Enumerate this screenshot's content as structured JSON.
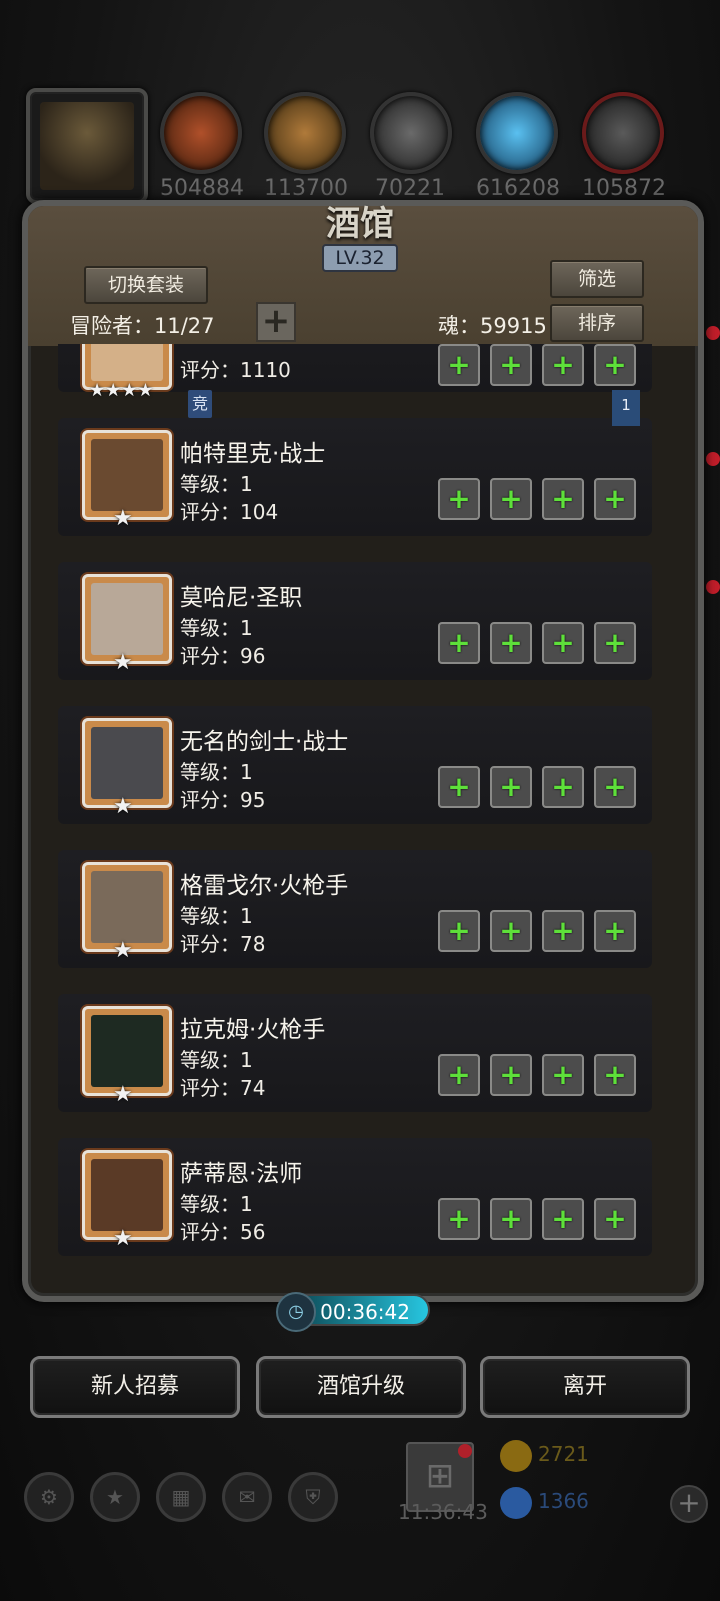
{
  "resources": [
    {
      "icon": "leather-icon",
      "value": "504884",
      "color": "#7a3a1a"
    },
    {
      "icon": "wood-icon",
      "value": "113700",
      "color": "#8a5a2a"
    },
    {
      "icon": "iron-icon",
      "value": "70221",
      "color": "#4a4a4a"
    },
    {
      "icon": "crystal-icon",
      "value": "616208",
      "color": "#2a8ac8"
    },
    {
      "icon": "ingot-icon",
      "value": "105872",
      "color": "#3a3a3a"
    }
  ],
  "tavern": {
    "title": "酒馆",
    "level": "LV.32",
    "switch_outfit": "切换套装",
    "filter": "筛选",
    "sort": "排序",
    "adventurers_label": "冒险者：11/27",
    "soul_label": "魂：59915",
    "tag_badge": "竞",
    "bookmark": "1"
  },
  "partial_card": {
    "stars": "★★★★",
    "score": "评分：1110"
  },
  "heroes": [
    {
      "name": "帕特里克·战士",
      "level": "等级：1",
      "score": "评分：104",
      "portrait": "#6a4a30"
    },
    {
      "name": "莫哈尼·圣职",
      "level": "等级：1",
      "score": "评分：96",
      "portrait": "#b8a898"
    },
    {
      "name": "无名的剑士·战士",
      "level": "等级：1",
      "score": "评分：95",
      "portrait": "#4a4a4e"
    },
    {
      "name": "格雷戈尔·火枪手",
      "level": "等级：1",
      "score": "评分：78",
      "portrait": "#7a6a5a"
    },
    {
      "name": "拉克姆·火枪手",
      "level": "等级：1",
      "score": "评分：74",
      "portrait": "#1e2a22"
    },
    {
      "name": "萨蒂恩·法师",
      "level": "等级：1",
      "score": "评分：56",
      "portrait": "#5a3a26"
    }
  ],
  "star_single": "★",
  "timer": "00:36:42",
  "buttons": {
    "recruit": "新人招募",
    "upgrade": "酒馆升级",
    "leave": "离开"
  },
  "bottom": {
    "clock": "11:36:43",
    "gold": "2721",
    "gems": "1366"
  }
}
